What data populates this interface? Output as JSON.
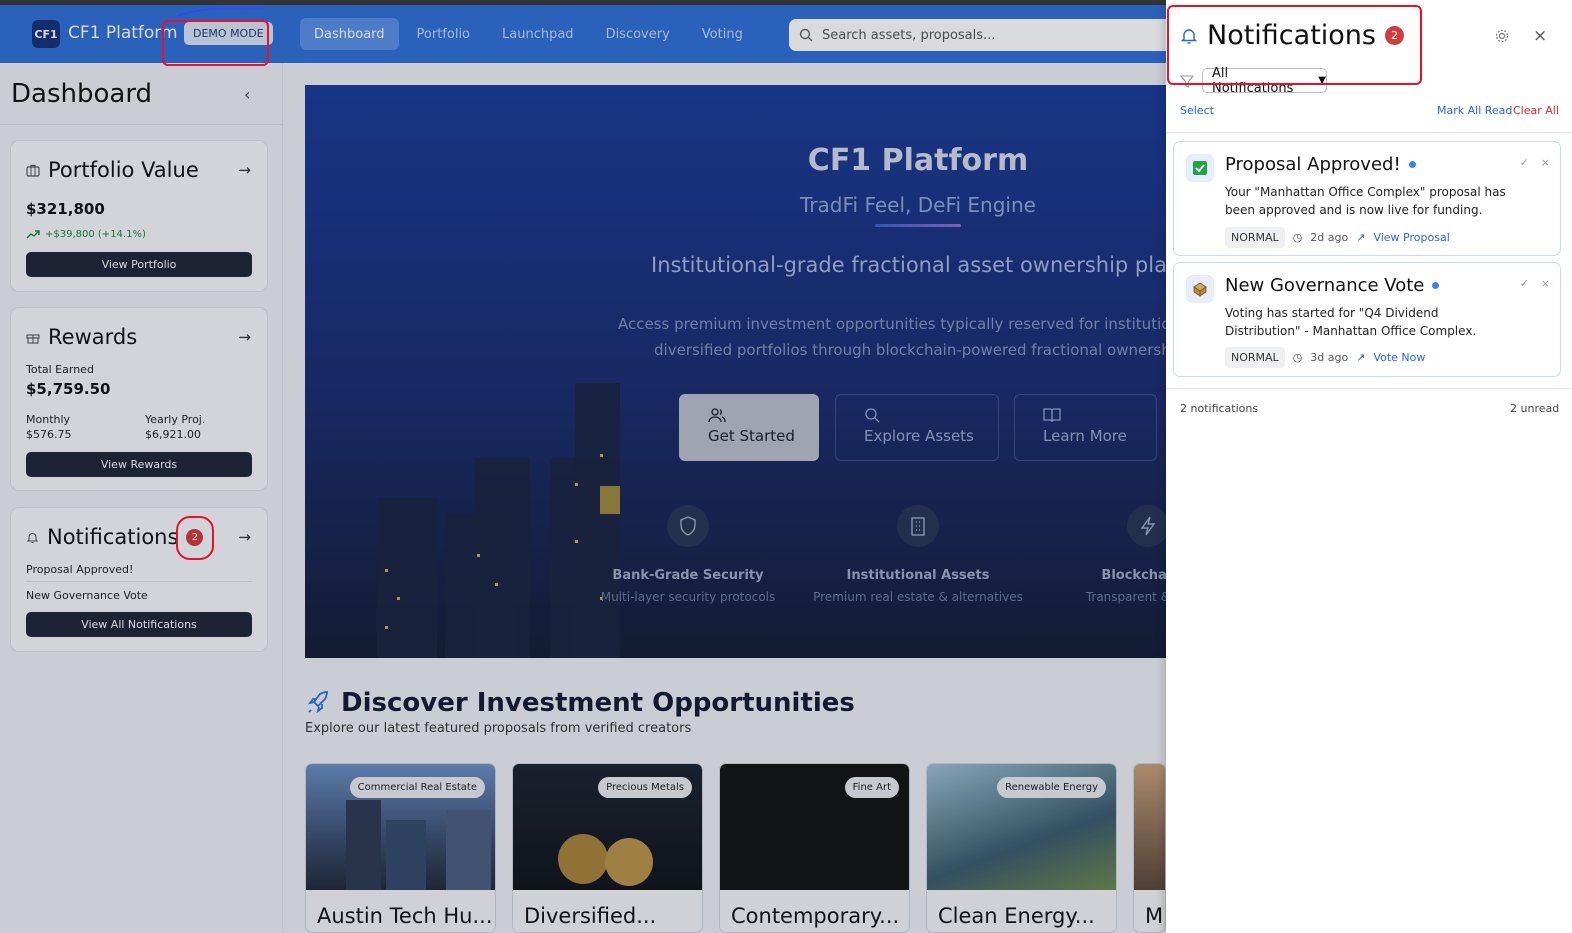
{
  "header": {
    "logo": "CF1",
    "brand": "CF1 Platform",
    "demo_badge": "DEMO MODE",
    "nav": [
      "Dashboard",
      "Portfolio",
      "Launchpad",
      "Discovery",
      "Voting"
    ],
    "search_placeholder": "Search assets, proposals..."
  },
  "sidebar": {
    "title": "Dashboard",
    "portfolio": {
      "title": "Portfolio Value",
      "value": "$321,800",
      "change": "+$39,800 (+14.1%)",
      "button": "View Portfolio"
    },
    "rewards": {
      "title": "Rewards",
      "total_label": "Total Earned",
      "total": "$5,759.50",
      "monthly_label": "Monthly",
      "monthly": "$576.75",
      "yearly_label": "Yearly Proj.",
      "yearly": "$6,921.00",
      "button": "View Rewards"
    },
    "notifications": {
      "title": "Notifications",
      "count": "2",
      "items": [
        "Proposal Approved!",
        "New Governance Vote"
      ],
      "button": "View All Notifications"
    }
  },
  "hero": {
    "title": "CF1 Platform",
    "tagline": "TradFi Feel, DeFi Engine",
    "headline": "Institutional-grade fractional asset ownership platfor",
    "desc_line1": "Access premium investment opportunities typically reserved for institution",
    "desc_line2": "diversified portfolios through blockchain-powered fractional ownershi",
    "buttons": [
      "Get Started",
      "Explore Assets",
      "Learn More"
    ],
    "features": [
      {
        "title": "Bank-Grade Security",
        "sub": "Multi-layer security protocols"
      },
      {
        "title": "Institutional Assets",
        "sub": "Premium real estate & alternatives"
      },
      {
        "title": "Blockchain P",
        "sub": "Transparent & efficie"
      }
    ]
  },
  "discover": {
    "title": "Discover Investment Opportunities",
    "subtitle": "Explore our latest featured proposals from verified creators",
    "cards": [
      {
        "tag": "Commercial Real Estate",
        "name": "Austin Tech Hu..."
      },
      {
        "tag": "Precious Metals",
        "name": "Diversified..."
      },
      {
        "tag": "Fine Art",
        "name": "Contemporary..."
      },
      {
        "tag": "Renewable Energy",
        "name": "Clean Energy..."
      },
      {
        "tag": "",
        "name": "Mi"
      }
    ]
  },
  "panel": {
    "title": "Notifications",
    "count": "2",
    "filter": "All Notifications",
    "select": "Select",
    "mark_all_read": "Mark All Read",
    "clear_all": "Clear All",
    "notifications": [
      {
        "title": "Proposal Approved!",
        "message": "Your \"Manhattan Office Complex\" proposal has been approved and is now live for funding.",
        "priority": "NORMAL",
        "time": "2d ago",
        "action": "View Proposal"
      },
      {
        "title": "New Governance Vote",
        "message": "Voting has started for \"Q4 Dividend Distribution\" - Manhattan Office Complex.",
        "priority": "NORMAL",
        "time": "3d ago",
        "action": "Vote Now"
      }
    ],
    "footer_count": "2 notifications",
    "footer_unread": "2 unread"
  },
  "colors": {
    "header_blue": "#2f6fd8",
    "accent": "#3b82f6",
    "danger": "#d23b3b",
    "annotation_red": "#e8102a"
  }
}
